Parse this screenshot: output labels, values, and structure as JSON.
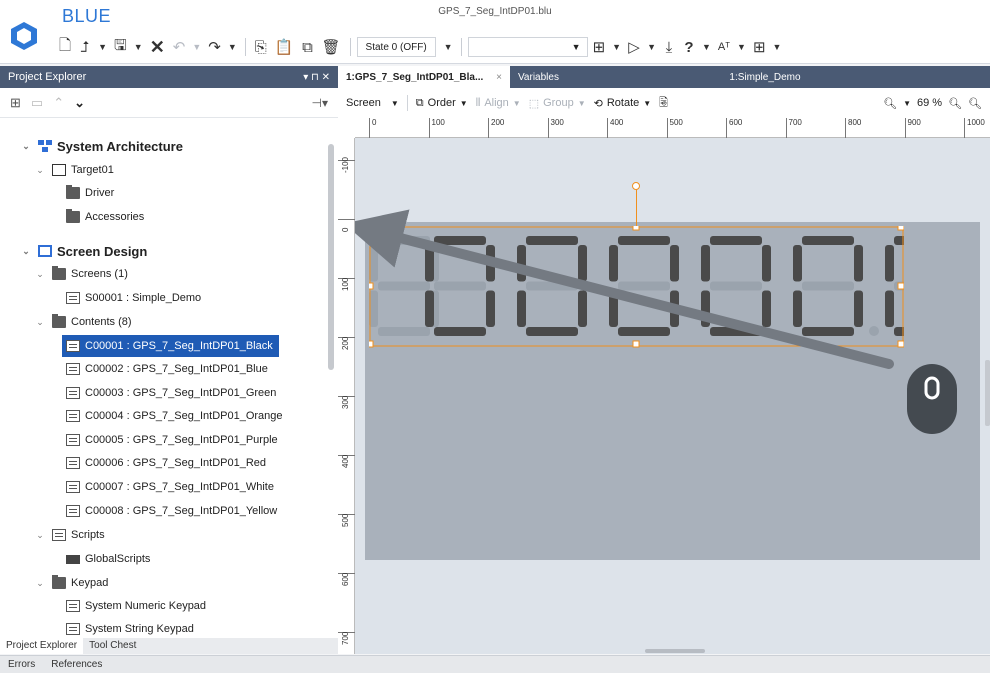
{
  "app": {
    "name": "BLUE",
    "document_title": "GPS_7_Seg_IntDP01.blu",
    "accent_color": "#2e78d6",
    "selection_color": "#1f5bb5"
  },
  "toolbar": {
    "state_label": "State 0 (OFF)",
    "icons": [
      "new-file-icon",
      "open-icon",
      "save-icon",
      "delete-icon",
      "undo-icon",
      "redo-icon",
      "copy-icon",
      "paste-icon",
      "duplicate-icon",
      "trash-icon",
      "layout-icon",
      "play-icon",
      "download-icon",
      "help-icon",
      "font-icon",
      "grid-icon"
    ]
  },
  "project_explorer": {
    "title": "Project Explorer",
    "header_controls": "▾ ⊓ ✕",
    "tree": {
      "system_architecture": "System Architecture",
      "target": "Target01",
      "driver": "Driver",
      "accessories": "Accessories",
      "screen_design": "Screen Design",
      "screens": "Screens (1)",
      "screen_item": "S00001 : Simple_Demo",
      "contents": "Contents (8)",
      "content_items": [
        "C00001 : GPS_7_Seg_IntDP01_Black",
        "C00002 : GPS_7_Seg_IntDP01_Blue",
        "C00003 : GPS_7_Seg_IntDP01_Green",
        "C00004 : GPS_7_Seg_IntDP01_Orange",
        "C00005 : GPS_7_Seg_IntDP01_Purple",
        "C00006 : GPS_7_Seg_IntDP01_Red",
        "C00007 : GPS_7_Seg_IntDP01_White",
        "C00008 : GPS_7_Seg_IntDP01_Yellow"
      ],
      "scripts": "Scripts",
      "global_scripts": "GlobalScripts",
      "keypad": "Keypad",
      "keypad_items": [
        "System Numeric Keypad",
        "System String Keypad"
      ]
    },
    "bottom_tabs": [
      "Project Explorer",
      "Tool Chest"
    ]
  },
  "editor_tabs": {
    "active": "1:GPS_7_Seg_IntDP01_Bla...",
    "close": "×",
    "variables": "Variables",
    "simple_demo": "1:Simple_Demo"
  },
  "editor_toolbar": {
    "screen": "Screen",
    "order": "Order",
    "align": "Align",
    "group": "Group",
    "rotate": "Rotate",
    "zoom": "69 %"
  },
  "ruler": {
    "h_labels": [
      "0",
      "100",
      "200",
      "300",
      "400",
      "500",
      "600",
      "700",
      "800",
      "900",
      "1000"
    ],
    "v_labels": [
      "-100",
      "0",
      "100",
      "200",
      "300",
      "400",
      "500",
      "600",
      "700"
    ]
  },
  "display": {
    "digit_count": 6,
    "digits": "00000.0",
    "segment_color": "#4a4a4a",
    "ghost_color": "#9aa3ad"
  },
  "status_tabs": [
    "Errors",
    "References"
  ]
}
